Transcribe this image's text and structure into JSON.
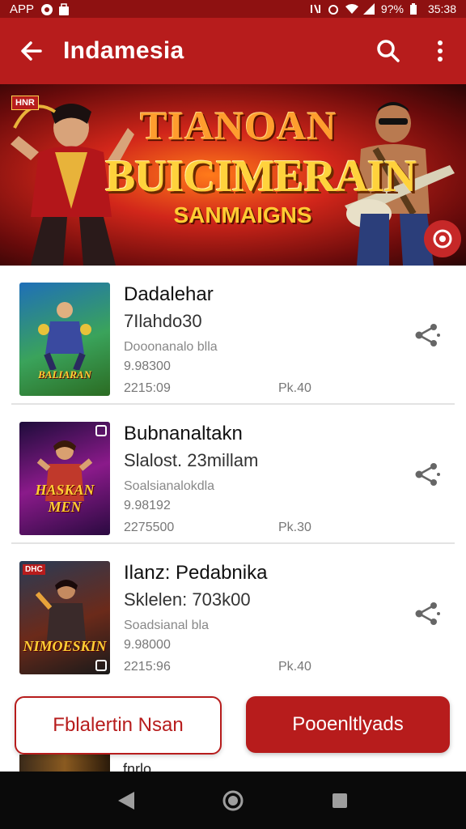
{
  "status_bar": {
    "app_label": "APP",
    "battery": "9?%",
    "time": "35:38"
  },
  "app_bar": {
    "title": "Indamesia"
  },
  "banner": {
    "badge": "HNR",
    "title_line_1": "TIANOAN",
    "title_line_2": "BUICIMERAIN",
    "title_line_3": "SANMAIGNS"
  },
  "items": [
    {
      "title": "Dadalehar",
      "subtitle": "7Ilahdo30",
      "meta": "Dooonanalo blla",
      "number": "9.98300",
      "date": "2215:09",
      "price": "Pk.40",
      "thumb_label": "BALIARAN"
    },
    {
      "title": "Bubnanaltakn",
      "subtitle": "Slalost. 23millam",
      "meta": "Soalsianalokdla",
      "number": "9.98192",
      "date": "2275500",
      "price": "Pk.30",
      "thumb_label": "HASKAN MEN"
    },
    {
      "title": "Ilanz: Pedabnika",
      "subtitle": "Sklelen: 703k00",
      "meta": "Soadsianal bla",
      "number": "9.98000",
      "date": "2215:96",
      "price": "Pk.40",
      "thumb_label": "NIMOESKIN",
      "thumb_badge": "DHC"
    }
  ],
  "actions": {
    "outline_label": "Fblalertin Nsan",
    "filled_label": "Pooenltlyads"
  },
  "peek": {
    "text": "fnrlo"
  },
  "colors": {
    "primary": "#b71c1c",
    "status_bar": "#8e1111",
    "nav_bar": "#0a0a0a"
  }
}
